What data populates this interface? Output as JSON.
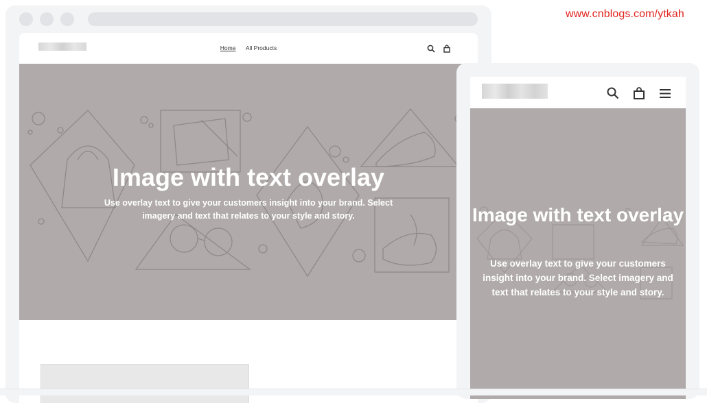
{
  "watermark": "www.cnblogs.com/ytkah",
  "desktop": {
    "nav": {
      "home": "Home",
      "all_products": "All Products"
    },
    "icons": {
      "search": "search-icon",
      "cart": "cart-icon"
    },
    "hero": {
      "title": "Image with text overlay",
      "text": "Use overlay text to give your customers insight into your brand. Select imagery and text that relates to your style and story."
    },
    "colors": {
      "hero_bg": "#b0aaaa",
      "frame": "#f3f4f6"
    }
  },
  "mobile": {
    "icons": {
      "search": "search-icon",
      "cart": "cart-icon",
      "menu": "hamburger-menu-icon"
    },
    "hero": {
      "title": "Image with text overlay",
      "text": "Use overlay text to give your customers insight into your brand. Select imagery and text that relates to your style and story."
    }
  }
}
